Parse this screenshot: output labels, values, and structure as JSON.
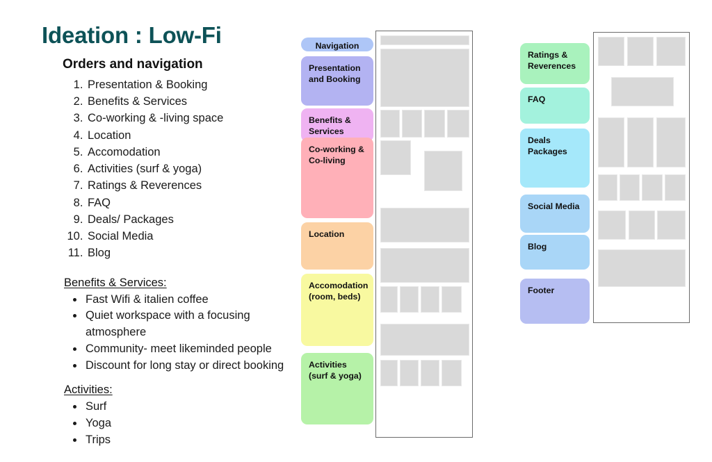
{
  "slide": {
    "title": "Ideation : Low-Fi",
    "title_color": "#0d5257",
    "background": "#ffffff"
  },
  "left_column": {
    "orders_heading": "Orders and navigation",
    "numbered_list": [
      "Presentation & Booking",
      "Benefits & Services",
      "Co-working & -living space",
      "Location",
      "Accomodation",
      "Activities (surf & yoga)",
      "Ratings & Reverences",
      "FAQ",
      "Deals/ Packages",
      "Social Media",
      "Blog"
    ],
    "benefits_heading": "Benefits & Services:",
    "benefits_bullets": [
      "Fast Wifi & italien coffee",
      "Quiet workspace with a focusing atmosphere",
      "Community- meet likeminded people",
      "Discount for long stay or direct booking"
    ],
    "activities_heading": "Activities:",
    "activities_bullets": [
      "Surf",
      "Yoga",
      "Trips"
    ]
  },
  "middle_flow": {
    "labels": [
      {
        "text": "Navigation",
        "color": "#aec6f7"
      },
      {
        "text": "Presentation\nand Booking",
        "color": "#b3b3f2"
      },
      {
        "text": "Benefits &\nServices",
        "color": "#efb3f2"
      },
      {
        "text": "Co-working &\nCo-living",
        "color": "#ffb0b8"
      },
      {
        "text": "Location",
        "color": "#fcd2a5"
      },
      {
        "text": "Accomodation\n(room, beds)",
        "color": "#f8f9a0"
      },
      {
        "text": "Activities\n(surf & yoga)",
        "color": "#b6f2a8"
      }
    ]
  },
  "right_flow": {
    "labels": [
      {
        "text": "Ratings &\nReverences",
        "color": "#a9f2bd"
      },
      {
        "text": "FAQ",
        "color": "#a3f2dd"
      },
      {
        "text": "Deals\nPackages",
        "color": "#a5e8fa"
      },
      {
        "text": "Social Media",
        "color": "#a9d6f7"
      },
      {
        "text": "Blog",
        "color": "#a9d6f7"
      },
      {
        "text": "Footer",
        "color": "#b6bef2"
      }
    ]
  },
  "wireframe": {
    "block_fill": "#d9d9d9",
    "frame_border": "#6b6b6b"
  }
}
